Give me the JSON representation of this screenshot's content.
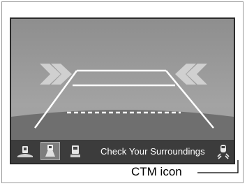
{
  "camera": {
    "mode_buttons": [
      {
        "name": "wide-view",
        "icon": "wide-view-icon",
        "selected": false
      },
      {
        "name": "normal-view",
        "icon": "normal-view-icon",
        "selected": true
      },
      {
        "name": "top-down-view",
        "icon": "top-down-view-icon",
        "selected": false
      }
    ],
    "status_text": "Check Your Surroundings",
    "status_icon": "ctm-icon",
    "colors": {
      "sky": "#9b9b9b",
      "ground": "#7a7a7a",
      "guide_lines": "#ffffff",
      "arrows": "#cfcfcf",
      "bar": "#3c3c3c",
      "selected_button": "#7d7d7d"
    }
  },
  "callout": {
    "label": "CTM icon"
  }
}
